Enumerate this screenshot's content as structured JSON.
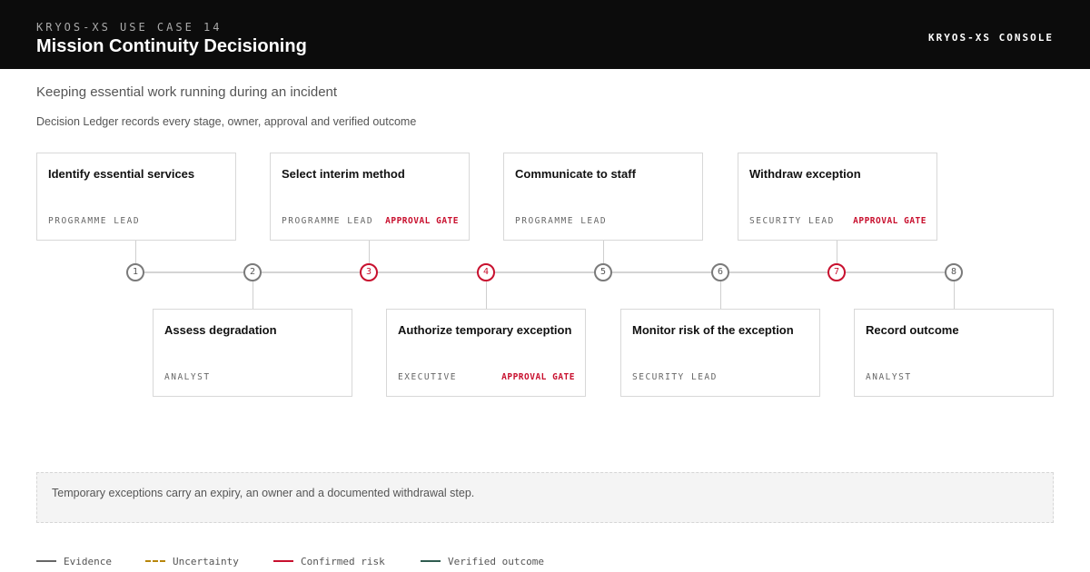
{
  "header": {
    "eyebrow": "KRYOS-XS USE CASE 14",
    "title": "Mission Continuity Decisioning",
    "console_label": "KRYOS-XS CONSOLE"
  },
  "subtitle": "Keeping essential work running during an incident",
  "ledger_note": "Decision Ledger records every stage, owner, approval and verified outcome",
  "steps": [
    {
      "number": "1",
      "title": "Identify essential services",
      "owner": "PROGRAMME LEAD",
      "gate": ""
    },
    {
      "number": "2",
      "title": "Assess degradation",
      "owner": "ANALYST",
      "gate": ""
    },
    {
      "number": "3",
      "title": "Select interim method",
      "owner": "PROGRAMME LEAD",
      "gate": "APPROVAL GATE"
    },
    {
      "number": "4",
      "title": "Authorize temporary exception",
      "owner": "EXECUTIVE",
      "gate": "APPROVAL GATE"
    },
    {
      "number": "5",
      "title": "Communicate to staff",
      "owner": "PROGRAMME LEAD",
      "gate": ""
    },
    {
      "number": "6",
      "title": "Monitor risk of the exception",
      "owner": "SECURITY LEAD",
      "gate": ""
    },
    {
      "number": "7",
      "title": "Withdraw exception",
      "owner": "SECURITY LEAD",
      "gate": "APPROVAL GATE"
    },
    {
      "number": "8",
      "title": "Record outcome",
      "owner": "ANALYST",
      "gate": ""
    }
  ],
  "footer_note": "Temporary exceptions carry an expiry, an owner and a documented withdrawal step.",
  "legend": [
    {
      "label": "Evidence",
      "color": "#666666",
      "style": "solid"
    },
    {
      "label": "Uncertainty",
      "color": "#b8860b",
      "style": "dashed"
    },
    {
      "label": "Confirmed risk",
      "color": "#c8102e",
      "style": "solid"
    },
    {
      "label": "Verified outcome",
      "color": "#2f5d50",
      "style": "solid"
    }
  ],
  "colors": {
    "gate_accent": "#c8102e",
    "node_default": "#7a7a7a"
  }
}
